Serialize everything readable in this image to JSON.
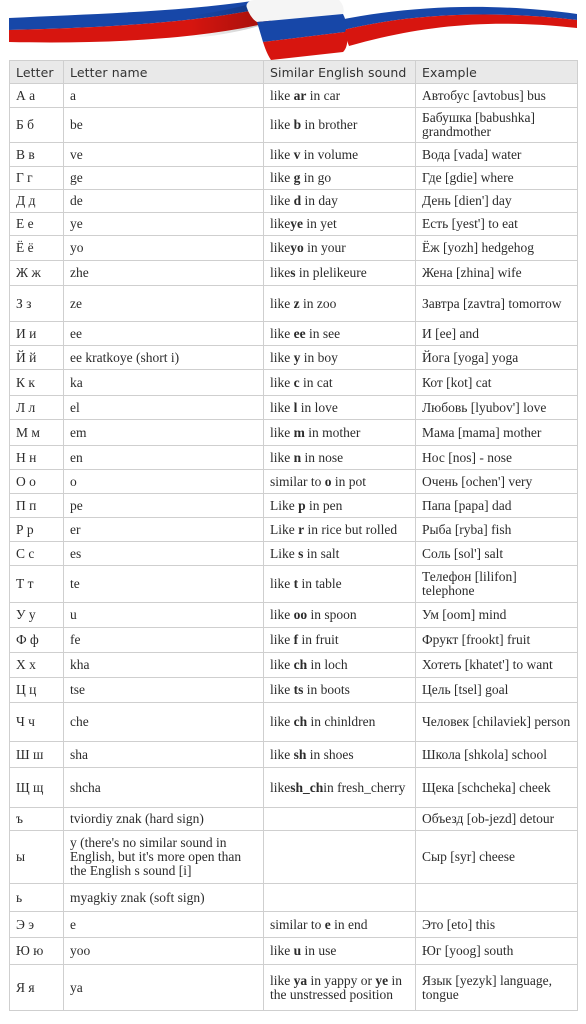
{
  "banner": {
    "icon": "russian-flag-ribbon",
    "colors": {
      "white": "#ffffff",
      "blue": "#1747a8",
      "red": "#d7150f"
    }
  },
  "table": {
    "headers": [
      "Letter",
      "Letter name",
      "Similar English sound",
      "Example"
    ],
    "rows": [
      {
        "letter": "А а",
        "name": "a",
        "sound": {
          "pre": "like ",
          "bold": "ar",
          "post": " in car"
        },
        "example": "Автобус [avtobus] bus"
      },
      {
        "letter": "Б б",
        "name": "be",
        "sound": {
          "pre": "like ",
          "bold": "b",
          "post": " in brother"
        },
        "example": "Бабушка [babushka] grandmother"
      },
      {
        "letter": "В в",
        "name": "ve",
        "sound": {
          "pre": "like ",
          "bold": "v",
          "post": " in volume"
        },
        "example": "Вода [vada] water"
      },
      {
        "letter": "Г г",
        "name": "ge",
        "sound": {
          "pre": "like ",
          "bold": "g",
          "post": " in go"
        },
        "example": "Где [gdie] where"
      },
      {
        "letter": "Д д",
        "name": "de",
        "sound": {
          "pre": "like ",
          "bold": "d",
          "post": " in day"
        },
        "example": "День [dien'] day"
      },
      {
        "letter": "Е е",
        "name": "ye",
        "sound": {
          "pre": "like",
          "bold": "ye",
          "post": " in yet"
        },
        "example": "Есть [yest'] to eat"
      },
      {
        "letter": "Ё ё",
        "name": "yo",
        "sound": {
          "pre": "like",
          "bold": "yo",
          "post": " in your"
        },
        "example": "Ёж [yozh] hedgehog"
      },
      {
        "letter": "Ж ж",
        "name": "zhe",
        "sound": {
          "pre": "like",
          "bold": "s",
          "post": " in plelikeure"
        },
        "example": "Жена [zhina] wife"
      },
      {
        "letter": "З з",
        "name": "ze",
        "sound": {
          "pre": "like ",
          "bold": "z",
          "post": " in zoo"
        },
        "example": "Завтра [zavtra] tomorrow"
      },
      {
        "letter": "И и",
        "name": "ee",
        "sound": {
          "pre": "like ",
          "bold": "ee",
          "post": " in see"
        },
        "example": "И [ee] and"
      },
      {
        "letter": "Й й",
        "name": "ee kratkoye (short i)",
        "sound": {
          "pre": "like ",
          "bold": "y",
          "post": " in boy"
        },
        "example": "Йога [yoga] yoga"
      },
      {
        "letter": "К к",
        "name": "ka",
        "sound": {
          "pre": "like ",
          "bold": "c",
          "post": " in cat"
        },
        "example": "Кот [kot] cat"
      },
      {
        "letter": "Л л",
        "name": "el",
        "sound": {
          "pre": "like ",
          "bold": "l",
          "post": " in love"
        },
        "example": "Любовь [lyubov'] love"
      },
      {
        "letter": "М м",
        "name": "em",
        "sound": {
          "pre": "like ",
          "bold": "m",
          "post": " in mother"
        },
        "example": "Мама [mama] mother"
      },
      {
        "letter": "Н н",
        "name": "en",
        "sound": {
          "pre": "like ",
          "bold": "n",
          "post": " in nose"
        },
        "example": "Нос [nos] - nose"
      },
      {
        "letter": "О о",
        "name": "o",
        "sound": {
          "pre": "similar to ",
          "bold": "o",
          "post": " in pot"
        },
        "example": "Очень [ochen'] very"
      },
      {
        "letter": "П п",
        "name": "pe",
        "sound": {
          "pre": "Like ",
          "bold": "p",
          "post": " in pen"
        },
        "example": "Папа [papa] dad"
      },
      {
        "letter": "Р р",
        "name": "er",
        "sound": {
          "pre": "Like ",
          "bold": "r",
          "post": " in rice but rolled"
        },
        "example": "Рыба [ryba] fish"
      },
      {
        "letter": "С с",
        "name": "es",
        "sound": {
          "pre": "Like ",
          "bold": "s",
          "post": " in salt"
        },
        "example": "Соль [sol'] salt"
      },
      {
        "letter": "Т т",
        "name": "te",
        "sound": {
          "pre": "like ",
          "bold": "t",
          "post": " in table"
        },
        "example": "Телефон [lilifon] telephone"
      },
      {
        "letter": "У у",
        "name": "u",
        "sound": {
          "pre": "like ",
          "bold": "oo",
          "post": " in spoon"
        },
        "example": "Ум [oom] mind"
      },
      {
        "letter": "Ф ф",
        "name": "fe",
        "sound": {
          "pre": "like ",
          "bold": "f",
          "post": " in fruit"
        },
        "example": "Фрукт [frookt] fruit"
      },
      {
        "letter": "Х х",
        "name": "kha",
        "sound": {
          "pre": "like ",
          "bold": "ch",
          "post": " in loch"
        },
        "example": "Хотеть [khatet'] to want"
      },
      {
        "letter": "Ц ц",
        "name": "tse",
        "sound": {
          "pre": "like ",
          "bold": "ts",
          "post": " in boots"
        },
        "example": "Цель [tsel] goal"
      },
      {
        "letter": "Ч ч",
        "name": "che",
        "sound": {
          "pre": "like ",
          "bold": "ch",
          "post": " in chinldren"
        },
        "example": "Человек [chilaviek] person"
      },
      {
        "letter": "Ш ш",
        "name": "sha",
        "sound": {
          "pre": "like ",
          "bold": "sh",
          "post": " in shoes"
        },
        "example": "Школа [shkola] school"
      },
      {
        "letter": "Щ щ",
        "name": "shcha",
        "sound": {
          "pre": "like",
          "bold": "sh_ch",
          "post": "in fresh_cherry"
        },
        "example": "Щека [schcheka] cheek"
      },
      {
        "letter": "ъ",
        "name": "tviordiy znak (hard sign)",
        "sound": null,
        "example": "Объезд [ob-jezd] detour"
      },
      {
        "letter": "ы",
        "name": "y (there's no similar sound in English, but it's more open than the English s sound [i]",
        "sound": null,
        "example": "Сыр [syr] cheese"
      },
      {
        "letter": "ь",
        "name": "myagkiy znak (soft sign)",
        "sound": null,
        "example": ""
      },
      {
        "letter": "Э э",
        "name": "e",
        "sound": {
          "pre": "similar to ",
          "bold": "e",
          "post": " in end"
        },
        "example": "Это [eto] this"
      },
      {
        "letter": "Ю ю",
        "name": "yoo",
        "sound": {
          "pre": "like ",
          "bold": "u",
          "post": " in use"
        },
        "example": "Юг [yoog] south"
      },
      {
        "letter": "Я я",
        "name": "ya",
        "sound": {
          "pre": "like ",
          "bold": "ya",
          "post": " in yappy or ",
          "bold2": "ye",
          "post2": " in the unstressed position"
        },
        "example": "Язык [yezyk] language, tongue"
      }
    ]
  }
}
